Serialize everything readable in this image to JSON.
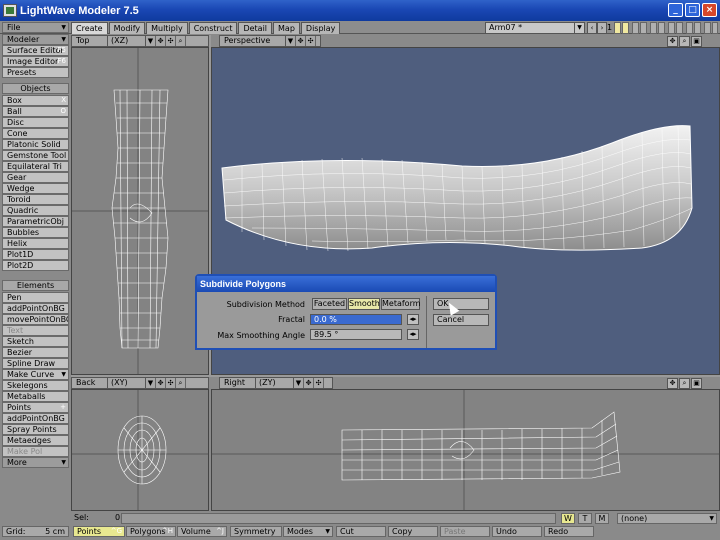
{
  "window": {
    "title": "LightWave Modeler 7.5",
    "min": "_",
    "max": "□",
    "close": "×"
  },
  "menu": {
    "file": "File",
    "modeler": "Modeler",
    "surface_editor": "Surface Editor",
    "surface_key": "F5",
    "image_editor": "Image Editor",
    "image_key": "F6",
    "presets": "Presets"
  },
  "tabs": [
    "Create",
    "Modify",
    "Multiply",
    "Construct",
    "Detail",
    "Map",
    "Display"
  ],
  "object_selector": "Arm07 *",
  "layer_count": "1",
  "objects": {
    "header": "Objects",
    "items": [
      {
        "label": "Box",
        "key": "X"
      },
      {
        "label": "Ball",
        "key": "O"
      },
      {
        "label": "Disc",
        "key": ""
      },
      {
        "label": "Cone",
        "key": ""
      },
      {
        "label": "Platonic Solid",
        "key": ""
      },
      {
        "label": "Gemstone Tool",
        "key": ""
      },
      {
        "label": "Equilateral Tri",
        "key": ""
      },
      {
        "label": "Gear",
        "key": ""
      },
      {
        "label": "Wedge",
        "key": ""
      },
      {
        "label": "Toroid",
        "key": ""
      },
      {
        "label": "Quadric",
        "key": ""
      },
      {
        "label": "ParametricObj",
        "key": ""
      },
      {
        "label": "Bubbles",
        "key": ""
      },
      {
        "label": "Helix",
        "key": ""
      },
      {
        "label": "Plot1D",
        "key": ""
      },
      {
        "label": "Plot2D",
        "key": ""
      }
    ]
  },
  "elements": {
    "header": "Elements",
    "items": [
      {
        "label": "Pen",
        "key": ""
      },
      {
        "label": "addPointOnBG",
        "key": ""
      },
      {
        "label": "movePointOnBG",
        "key": ""
      },
      {
        "label": "Text",
        "key": ""
      },
      {
        "label": "Sketch",
        "key": ""
      },
      {
        "label": "Bezier",
        "key": ""
      },
      {
        "label": "Spline Draw",
        "key": ""
      },
      {
        "label": "Make Curve",
        "key": ""
      },
      {
        "label": "Skelegons",
        "key": ""
      },
      {
        "label": "Metaballs",
        "key": ""
      },
      {
        "label": "Points",
        "key": "+"
      },
      {
        "label": "addPointOnBG",
        "key": ""
      },
      {
        "label": "Spray Points",
        "key": ""
      },
      {
        "label": "Metaedges",
        "key": ""
      },
      {
        "label": "Make Pol",
        "key": ""
      },
      {
        "label": "More",
        "key": ""
      }
    ]
  },
  "viewports": {
    "top": {
      "view": "Top",
      "axis": "(XZ)"
    },
    "persp": {
      "view": "Perspective"
    },
    "back": {
      "view": "Back",
      "axis": "(XY)"
    },
    "right": {
      "view": "Right",
      "axis": "(ZY)"
    }
  },
  "dialog": {
    "title": "Subdivide Polygons",
    "method_label": "Subdivision Method",
    "methods": [
      "Faceted",
      "Smooth",
      "Metaform"
    ],
    "selected_method": "Smooth",
    "fractal_label": "Fractal",
    "fractal_value": "0.0 %",
    "angle_label": "Max Smoothing Angle",
    "angle_value": "89.5 °",
    "ok": "OK",
    "cancel": "Cancel"
  },
  "status": {
    "sel_label": "Sel:",
    "sel_value": "0",
    "grid_label": "Grid:",
    "grid_value": "5 cm",
    "modes": [
      {
        "label": "Points",
        "key": "^G"
      },
      {
        "label": "Polygons",
        "key": "^H"
      },
      {
        "label": "Volume",
        "key": "^J"
      }
    ],
    "symmetry": "Symmetry",
    "modes_menu": "Modes",
    "cut": "Cut",
    "copy": "Copy",
    "paste": "Paste",
    "undo": "Undo",
    "redo": "Redo",
    "wtm": [
      "W",
      "T",
      "M"
    ],
    "vmap": "(none)"
  }
}
